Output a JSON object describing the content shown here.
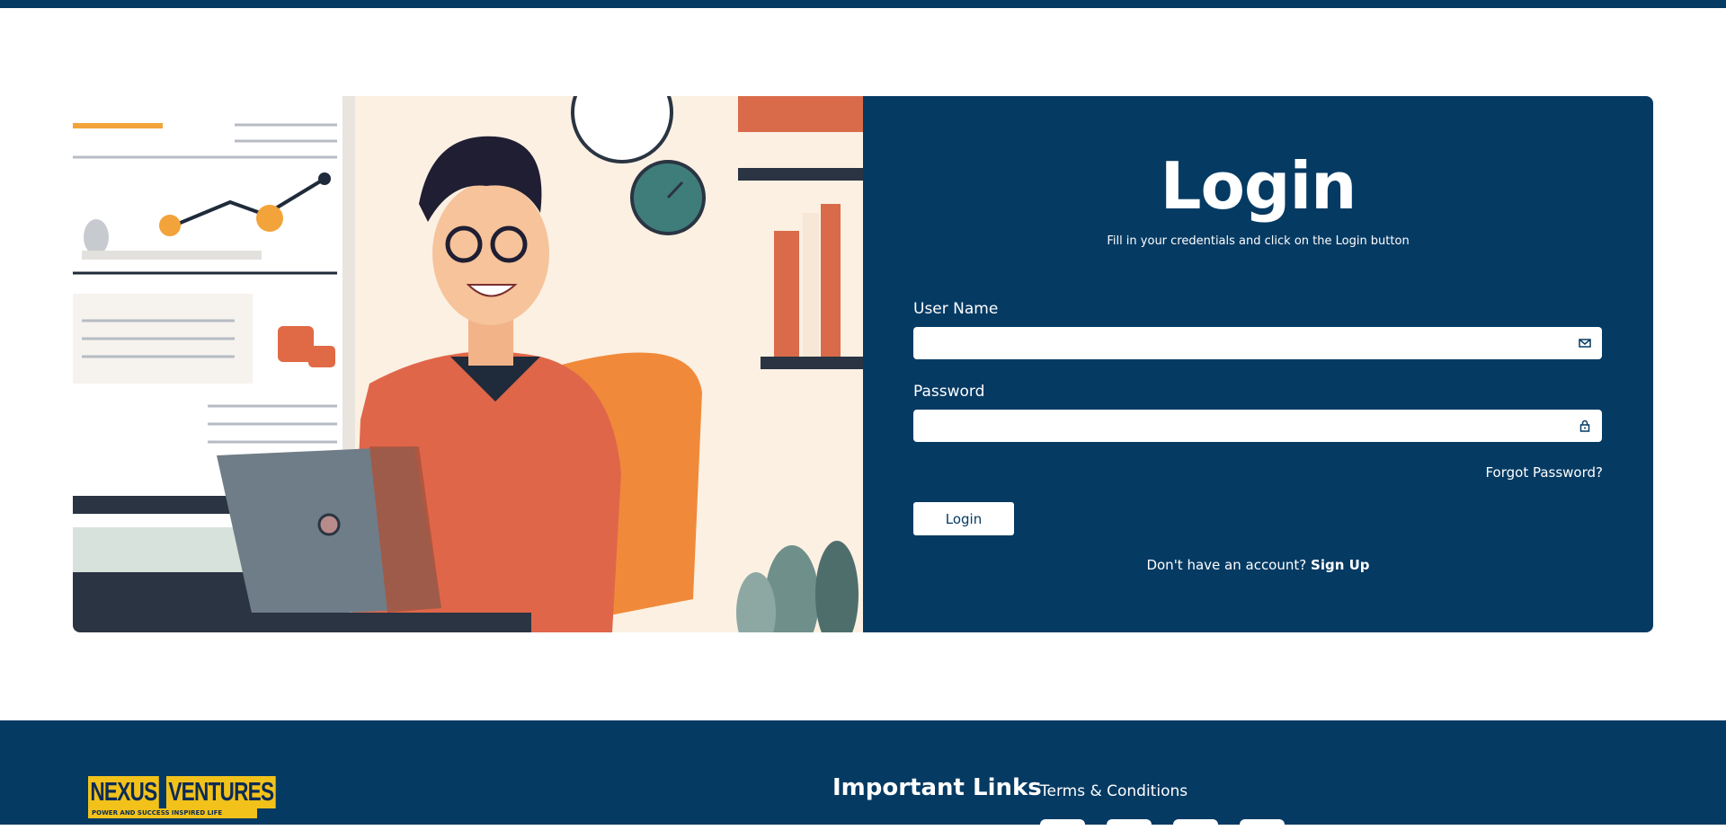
{
  "login": {
    "title": "Login",
    "subtitle": "Fill in your credentials and click on the Login button",
    "username_label": "User Name",
    "username_value": "",
    "password_label": "Password",
    "password_value": "",
    "forgot_label": "Forgot Password?",
    "submit_label": "Login",
    "signup_prompt": "Don't have an account?",
    "signup_link": "Sign Up"
  },
  "icons": {
    "username_icon": "mail-icon",
    "password_icon": "lock-icon"
  },
  "footer": {
    "logo_left": "NEXUS",
    "logo_right": "VENTURES",
    "logo_tagline": "POWER AND SUCCESS INSPIRED LIFE",
    "links_heading": "Important Links",
    "terms_link": "Terms & Conditions"
  },
  "colors": {
    "brand_navy": "#053a63",
    "logo_yellow": "#f2c21b"
  }
}
